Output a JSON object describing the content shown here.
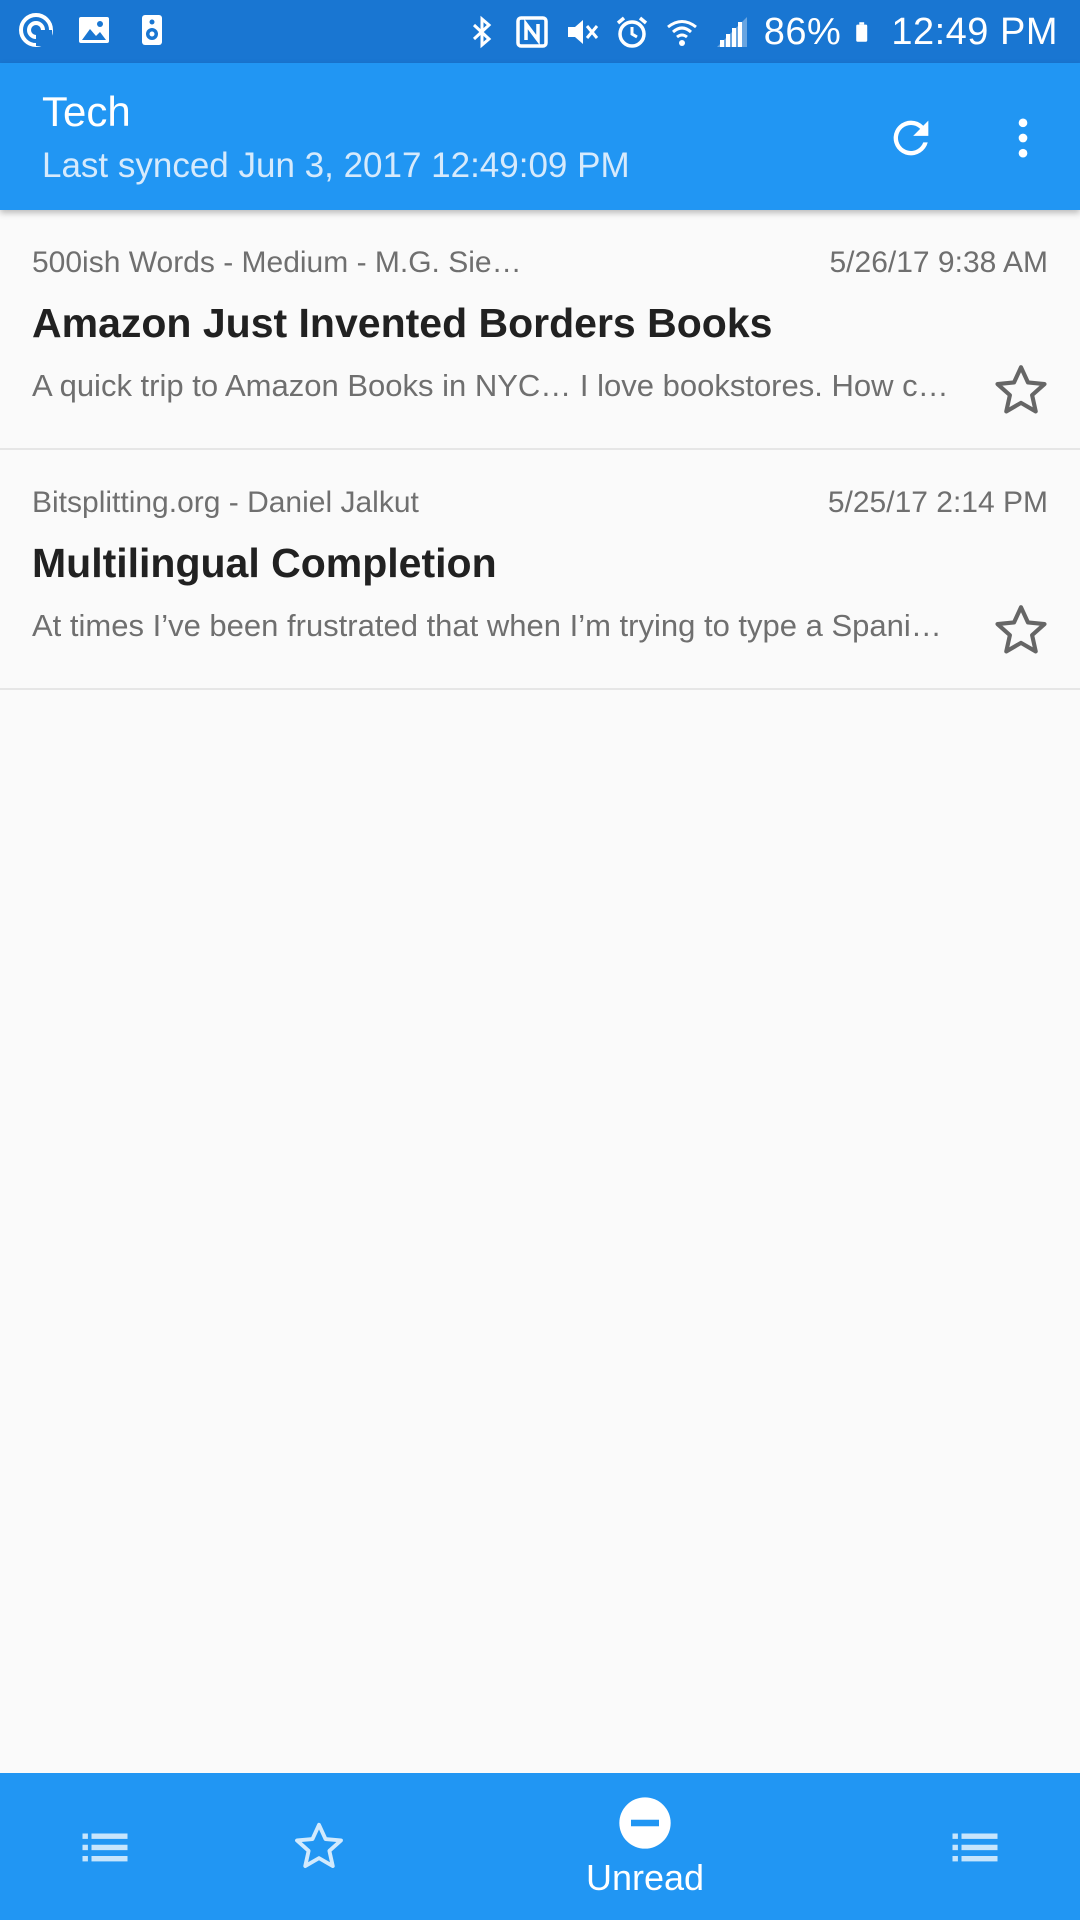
{
  "status_bar": {
    "battery": "86%",
    "time": "12:49 PM"
  },
  "app_bar": {
    "title": "Tech",
    "subtitle": "Last synced Jun 3, 2017 12:49:09 PM",
    "icons": [
      "refresh-icon",
      "more-vert-icon"
    ]
  },
  "articles": [
    {
      "source": "500ish Words - Medium - M.G. Sie…",
      "date": "5/26/17 9:38 AM",
      "title": "Amazon Just Invented Borders Books",
      "snippet": "A quick trip to Amazon Books in NYC… I love bookstores. How c…",
      "starred": false
    },
    {
      "source": "Bitsplitting.org - Daniel Jalkut",
      "date": "5/25/17 2:14 PM",
      "title": "Multilingual Completion",
      "snippet": "At times I’ve been frustrated that when I’m trying to type a Spani…",
      "starred": false
    }
  ],
  "bottom_nav": {
    "active_label": "Unread",
    "items": [
      "list-icon",
      "star-icon",
      "unread-icon",
      "list-icon"
    ]
  },
  "colors": {
    "status_bar": "#1976d2",
    "primary": "#2196f3",
    "background": "#fafafa"
  }
}
